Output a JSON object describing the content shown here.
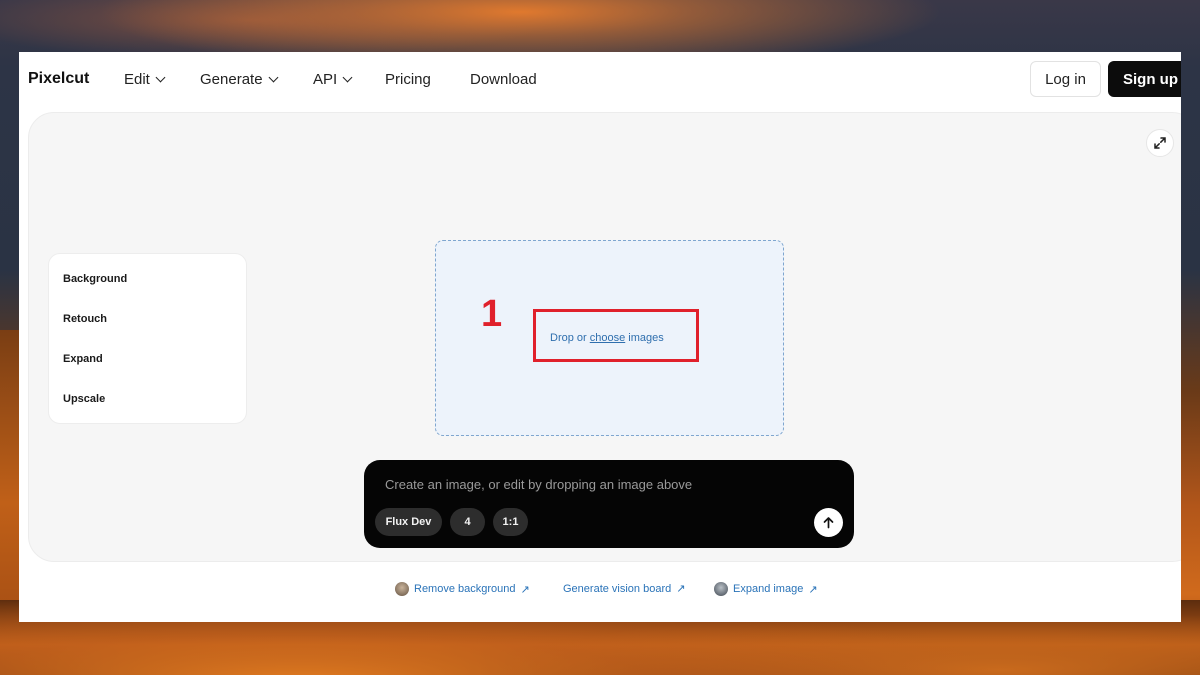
{
  "nav": {
    "logo": "Pixelcut",
    "items": [
      {
        "label": "Edit",
        "dropdown": true
      },
      {
        "label": "Generate",
        "dropdown": true
      },
      {
        "label": "API",
        "dropdown": true
      },
      {
        "label": "Pricing",
        "dropdown": false
      },
      {
        "label": "Download",
        "dropdown": false
      }
    ],
    "login_label": "Log in",
    "signup_label": "Sign up"
  },
  "sidebar": {
    "items": [
      {
        "label": "Background"
      },
      {
        "label": "Retouch"
      },
      {
        "label": "Expand"
      },
      {
        "label": "Upscale"
      }
    ]
  },
  "dropzone": {
    "prefix": "Drop or",
    "link": "choose",
    "suffix": "images"
  },
  "annotation": {
    "step_number": "1",
    "color": "#e0202b"
  },
  "prompt": {
    "placeholder": "Create an image, or edit by dropping an image above",
    "chips": [
      {
        "label": "Flux Dev"
      },
      {
        "label": "4"
      },
      {
        "label": "1:1"
      }
    ],
    "send_icon": "arrow-up-icon"
  },
  "links": [
    {
      "label": "Remove background",
      "icon": "avatar-thumbnail"
    },
    {
      "label": "Generate vision board",
      "icon": null
    },
    {
      "label": "Expand image",
      "icon": "avatar-thumbnail"
    }
  ],
  "colors": {
    "link": "#2a73b8",
    "accent_dark": "#0c0c0c",
    "dropzone_bg": "#edf3fb"
  }
}
